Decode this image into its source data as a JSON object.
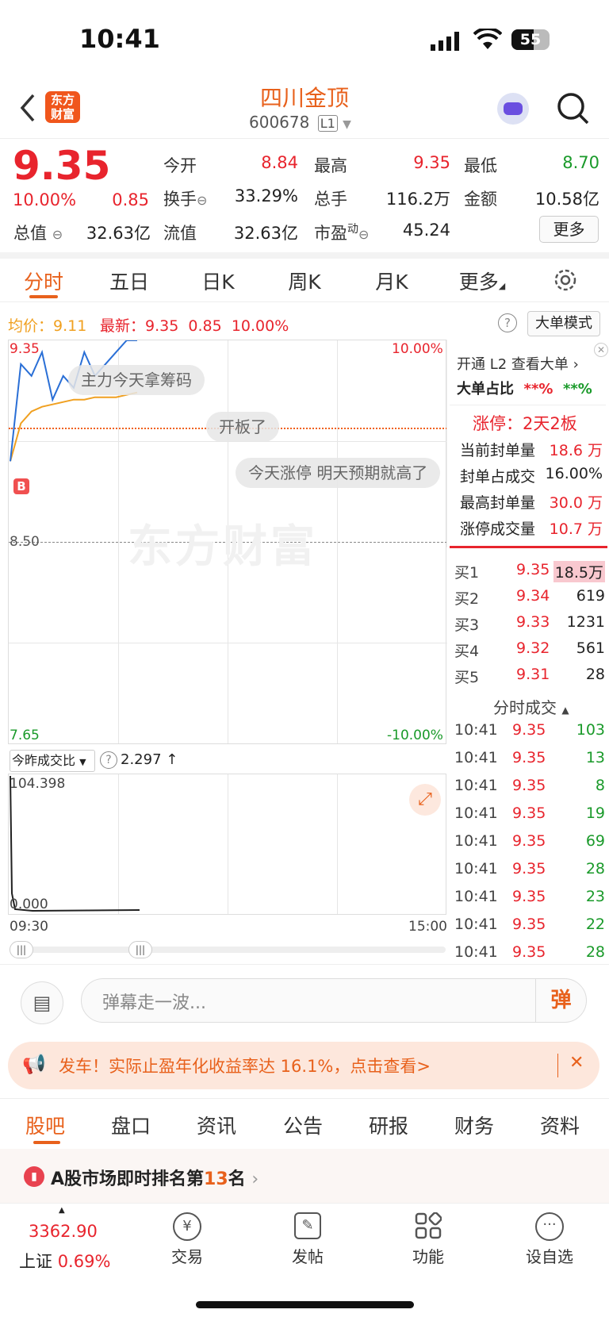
{
  "status": {
    "time": "10:41",
    "battery": "55"
  },
  "header": {
    "logo": "东方财富",
    "name": "四川金顶",
    "code": "600678",
    "level": "L1"
  },
  "quote": {
    "price": "9.35",
    "pct": "10.00%",
    "chg": "0.85",
    "open_label": "今开",
    "open": "8.84",
    "high_label": "最高",
    "high": "9.35",
    "low_label": "最低",
    "low": "8.70",
    "turnover_label": "换手",
    "turnover": "33.29%",
    "volume_label": "总手",
    "volume": "116.2万",
    "amount_label": "金额",
    "amount": "10.58亿",
    "mcap_label": "总值",
    "mcap": "32.63亿",
    "float_label": "流值",
    "float": "32.63亿",
    "pe_label": "市盈",
    "pe_sup": "动",
    "pe": "45.24",
    "more": "更多"
  },
  "tabs": [
    "分时",
    "五日",
    "日K",
    "周K",
    "月K",
    "更多"
  ],
  "chart_bar": {
    "avg_label": "均价：",
    "avg": "9.11",
    "latest_label": "最新：",
    "latest": "9.35",
    "chg": "0.85",
    "pct": "10.00%",
    "mode_btn": "大单模式"
  },
  "chart": {
    "y_top": "9.35",
    "y_mid": "8.50",
    "y_bottom": "7.65",
    "pct_top": "10.00%",
    "pct_bottom": "-10.00%",
    "x_start": "09:30",
    "x_end": "15:00",
    "watermark": "东方财富",
    "bullets": [
      "主力今天拿筹码",
      "开板了",
      "今天涨停 明天预期就高了"
    ],
    "b_marker": "B",
    "vol_ratio_label": "今昨成交比",
    "vol_ratio": "2.297 ↑",
    "vol_max": "104.398",
    "vol_min": "0.000"
  },
  "chart_data": {
    "type": "line",
    "series": [
      {
        "name": "均价",
        "values": [
          8.84,
          9.0,
          9.05,
          9.07,
          9.08,
          9.09,
          9.1,
          9.1,
          9.11,
          9.11,
          9.11,
          9.12,
          9.13
        ]
      },
      {
        "name": "最新",
        "values": [
          8.84,
          9.25,
          9.2,
          9.3,
          9.1,
          9.2,
          9.15,
          9.3,
          9.2,
          9.25,
          9.3,
          9.35,
          9.35
        ]
      }
    ],
    "ylim": [
      7.65,
      9.35
    ]
  },
  "l2": {
    "promo": "开通 L2 查看大单 ›",
    "ratio_label": "大单占比",
    "ratio_in": "**%",
    "ratio_out": "**%",
    "limit_title": "涨停：2天2板",
    "rows": [
      {
        "label": "当前封单量",
        "value": "18.6 万"
      },
      {
        "label": "封单占成交",
        "value": "16.00%"
      },
      {
        "label": "最高封单量",
        "value": "30.0 万"
      },
      {
        "label": "涨停成交量",
        "value": "10.7 万"
      }
    ]
  },
  "orderbook": [
    {
      "label": "买1",
      "price": "9.35",
      "vol": "18.5万"
    },
    {
      "label": "买2",
      "price": "9.34",
      "vol": "619"
    },
    {
      "label": "买3",
      "price": "9.33",
      "vol": "1231"
    },
    {
      "label": "买4",
      "price": "9.32",
      "vol": "561"
    },
    {
      "label": "买5",
      "price": "9.31",
      "vol": "28"
    }
  ],
  "trades_title": "分时成交",
  "trades": [
    {
      "t": "10:41",
      "p": "9.35",
      "v": "103"
    },
    {
      "t": "10:41",
      "p": "9.35",
      "v": "13"
    },
    {
      "t": "10:41",
      "p": "9.35",
      "v": "8"
    },
    {
      "t": "10:41",
      "p": "9.35",
      "v": "19"
    },
    {
      "t": "10:41",
      "p": "9.35",
      "v": "69"
    },
    {
      "t": "10:41",
      "p": "9.35",
      "v": "28"
    },
    {
      "t": "10:41",
      "p": "9.35",
      "v": "23"
    },
    {
      "t": "10:41",
      "p": "9.35",
      "v": "22"
    },
    {
      "t": "10:41",
      "p": "9.35",
      "v": "28"
    }
  ],
  "comment": {
    "placeholder": "弹幕走一波...",
    "danmu_btn": "弹"
  },
  "banner": {
    "text": "发车！实际止盈年化收益率达 16.1%，点击查看>"
  },
  "bottom_tabs": [
    "股吧",
    "盘口",
    "资讯",
    "公告",
    "研报",
    "财务",
    "资料"
  ],
  "rank": {
    "prefix": "A股市场即时排名第",
    "num": "13",
    "suffix": "名"
  },
  "index": {
    "value": "3362.90",
    "name": "上证",
    "pct": "0.69%"
  },
  "nav": [
    "交易",
    "发帖",
    "功能",
    "设自选"
  ]
}
